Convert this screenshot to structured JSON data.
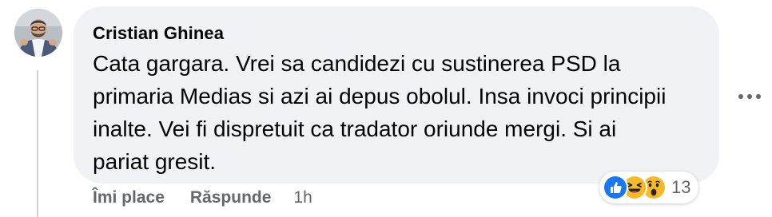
{
  "comment": {
    "author": "Cristian Ghinea",
    "text": "Cata gargara. Vrei sa candidezi cu sustinerea PSD la primaria Medias si azi ai depus obolul. Insa invoci principii inalte. Vei fi dispretuit ca tradator oriunde mergi. Si ai pariat gresit."
  },
  "actions": {
    "like_label": "Îmi place",
    "reply_label": "Răspunde",
    "timestamp": "1h"
  },
  "reactions": {
    "icons": [
      "like-icon",
      "haha-icon",
      "wow-icon"
    ],
    "count": "13"
  },
  "colors": {
    "bubble": "#f0f2f5",
    "text": "#050505",
    "secondary": "#65676b",
    "like_blue": "#1877f2",
    "emoji_yellow": "#f7b928"
  }
}
